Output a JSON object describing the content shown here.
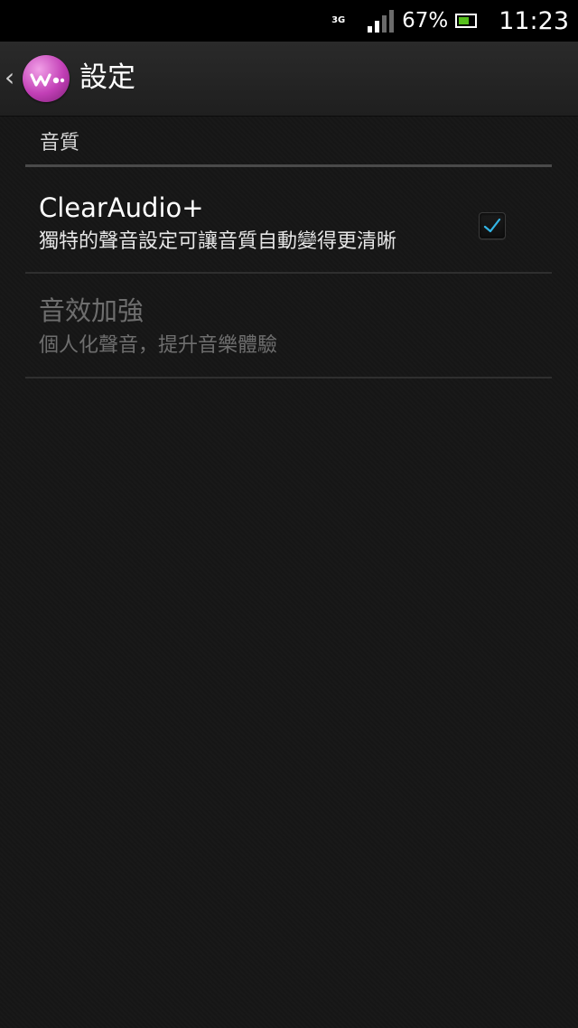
{
  "status_bar": {
    "network_type": "3G",
    "battery_percent": "67%",
    "battery_level": 0.67,
    "time": "11:23",
    "signal_icon": "signal-icon",
    "battery_icon": "battery-icon"
  },
  "action_bar": {
    "title": "設定",
    "back_icon": "chevron-left-icon",
    "logo_icon": "walkman-logo-icon"
  },
  "settings": {
    "category": "音質",
    "items": [
      {
        "title": "ClearAudio+",
        "summary": "獨特的聲音設定可讓音質自動變得更清晰",
        "checked": true,
        "enabled": true
      },
      {
        "title": "音效加強",
        "summary": "個人化聲音，提升音樂體驗",
        "enabled": false
      }
    ]
  },
  "colors": {
    "accent": "#33b5e5",
    "background": "#161616",
    "status_bar": "#000000",
    "logo": "#c23fb6",
    "battery_fill": "#57c01d"
  }
}
